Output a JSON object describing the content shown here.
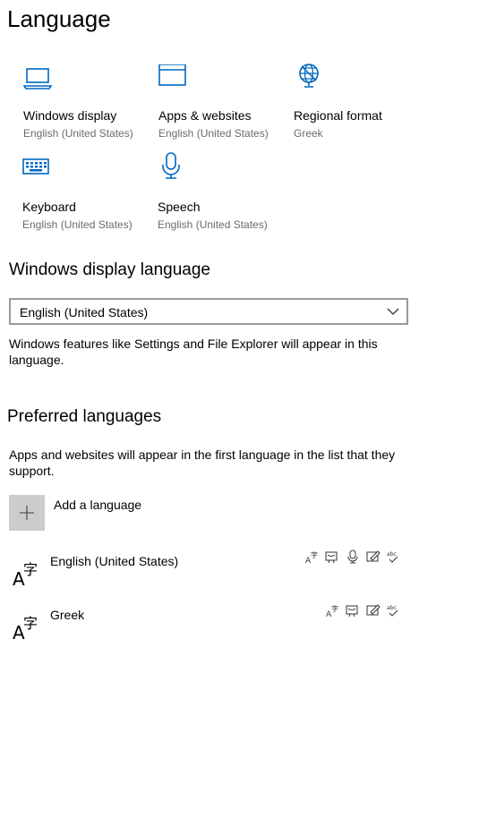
{
  "page": {
    "title": "Language"
  },
  "tiles": [
    {
      "title": "Windows display",
      "subtitle": "English (United States)",
      "icon": "laptop-icon"
    },
    {
      "title": "Apps & websites",
      "subtitle": "English (United States)",
      "icon": "browser-window-icon"
    },
    {
      "title": "Regional format",
      "subtitle": "Greek",
      "icon": "globe-icon"
    },
    {
      "title": "Keyboard",
      "subtitle": "English (United States)",
      "icon": "keyboard-icon"
    },
    {
      "title": "Speech",
      "subtitle": "English (United States)",
      "icon": "microphone-icon"
    }
  ],
  "display_language": {
    "heading": "Windows display language",
    "selected": "English (United States)",
    "description": "Windows features like Settings and File Explorer will appear in this language."
  },
  "preferred": {
    "heading": "Preferred languages",
    "description": "Apps and websites will appear in the first language in the list that they support.",
    "add_label": "Add a language",
    "languages": [
      {
        "name": "English (United States)",
        "features": [
          "language-pack-icon",
          "text-to-speech-icon",
          "speech-recognition-icon",
          "handwriting-icon",
          "spellcheck-icon"
        ]
      },
      {
        "name": "Greek",
        "features": [
          "language-pack-icon",
          "text-to-speech-icon",
          "handwriting-icon",
          "spellcheck-icon"
        ]
      }
    ]
  },
  "colors": {
    "accent": "#0067c0",
    "button_bg": "#cccccc",
    "dropdown_border": "#999999",
    "secondary_text": "#6b6b6b"
  }
}
